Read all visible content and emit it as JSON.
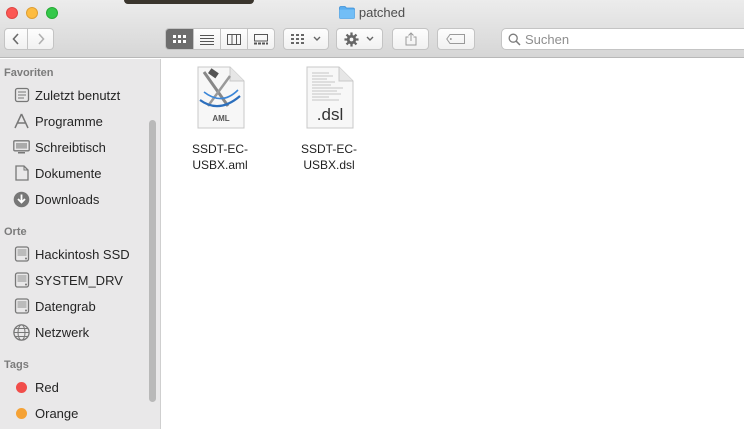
{
  "window": {
    "title": "patched"
  },
  "toolbar": {
    "view_modes": [
      "icon-view",
      "list-view",
      "column-view",
      "gallery-view"
    ],
    "active_view": "icon-view"
  },
  "search": {
    "placeholder": "Suchen",
    "value": ""
  },
  "sidebar": {
    "favorites_header": "Favoriten",
    "favorites": [
      {
        "label": "Zuletzt benutzt",
        "icon": "recents-icon"
      },
      {
        "label": "Programme",
        "icon": "applications-icon"
      },
      {
        "label": "Schreibtisch",
        "icon": "desktop-icon"
      },
      {
        "label": "Dokumente",
        "icon": "documents-icon"
      },
      {
        "label": "Downloads",
        "icon": "downloads-icon"
      }
    ],
    "locations_header": "Orte",
    "locations": [
      {
        "label": "Hackintosh SSD",
        "icon": "disk-icon"
      },
      {
        "label": "SYSTEM_DRV",
        "icon": "disk-icon"
      },
      {
        "label": "Datengrab",
        "icon": "disk-icon"
      },
      {
        "label": "Netzwerk",
        "icon": "network-icon"
      }
    ],
    "tags_header": "Tags",
    "tags": [
      {
        "label": "Red",
        "color": "#f14d4a"
      },
      {
        "label": "Orange",
        "color": "#f5a235"
      }
    ]
  },
  "files": [
    {
      "name": "SSDT-EC-\nUSBX.aml",
      "icon": "aml-file-icon",
      "badge": "AML"
    },
    {
      "name": "SSDT-EC-\nUSBX.dsl",
      "icon": "dsl-file-icon",
      "badge": ".dsl"
    }
  ]
}
